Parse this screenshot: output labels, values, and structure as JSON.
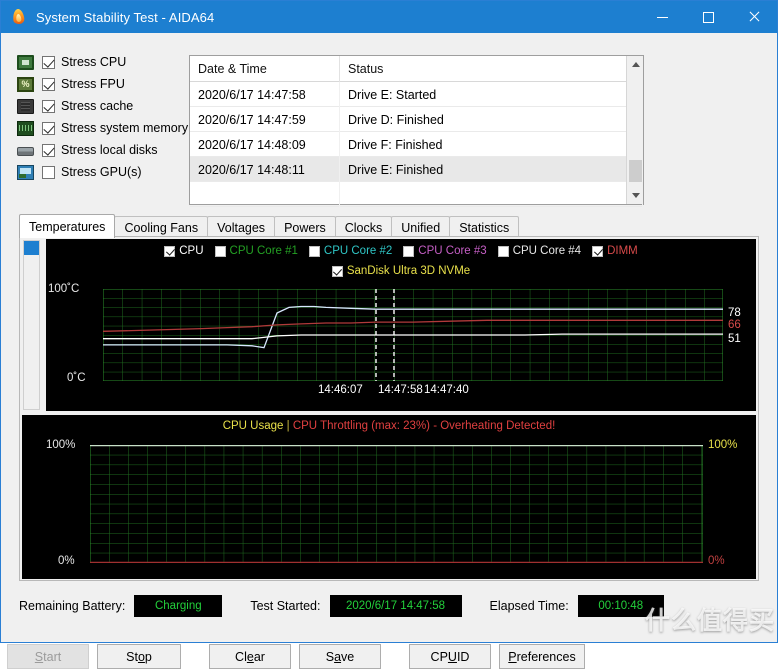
{
  "window": {
    "title": "System Stability Test - AIDA64",
    "icon": "flame-icon",
    "minimize": "—",
    "maximize": "☐",
    "close": "✕"
  },
  "stress_options": [
    {
      "label": "Stress CPU",
      "checked": true,
      "icon": "cpu-icon"
    },
    {
      "label": "Stress FPU",
      "checked": true,
      "icon": "fpu-icon"
    },
    {
      "label": "Stress cache",
      "checked": true,
      "icon": "cache-icon"
    },
    {
      "label": "Stress system memory",
      "checked": true,
      "icon": "memory-icon"
    },
    {
      "label": "Stress local disks",
      "checked": true,
      "icon": "disk-icon"
    },
    {
      "label": "Stress GPU(s)",
      "checked": false,
      "icon": "gpu-icon"
    }
  ],
  "log": {
    "columns": [
      "Date & Time",
      "Status"
    ],
    "rows": [
      {
        "datetime": "2020/6/17 14:47:58",
        "status": "Drive E: Started",
        "selected": false
      },
      {
        "datetime": "2020/6/17 14:47:59",
        "status": "Drive D: Finished",
        "selected": false
      },
      {
        "datetime": "2020/6/17 14:48:09",
        "status": "Drive F: Finished",
        "selected": false
      },
      {
        "datetime": "2020/6/17 14:48:11",
        "status": "Drive E: Finished",
        "selected": true
      }
    ]
  },
  "tabs": [
    {
      "label": "Temperatures",
      "active": true
    },
    {
      "label": "Cooling Fans",
      "active": false
    },
    {
      "label": "Voltages",
      "active": false
    },
    {
      "label": "Powers",
      "active": false
    },
    {
      "label": "Clocks",
      "active": false
    },
    {
      "label": "Unified",
      "active": false
    },
    {
      "label": "Statistics",
      "active": false
    }
  ],
  "sensor_legend": [
    {
      "label": "CPU",
      "checked": true,
      "color": "#ffffff"
    },
    {
      "label": "CPU Core #1",
      "checked": false,
      "color": "#24a024"
    },
    {
      "label": "CPU Core #2",
      "checked": false,
      "color": "#2fc6c6"
    },
    {
      "label": "CPU Core #3",
      "checked": false,
      "color": "#c65fc6"
    },
    {
      "label": "CPU Core #4",
      "checked": false,
      "color": "#e8e8e8"
    },
    {
      "label": "DIMM",
      "checked": true,
      "color": "#d64a4a"
    }
  ],
  "sensor_legend_row2": [
    {
      "label": "SanDisk Ultra 3D NVMe",
      "checked": true,
      "color": "#e8e04a"
    }
  ],
  "usage_title": {
    "main": "CPU Usage",
    "separator": "|",
    "warning": "CPU Throttling (max: 23%) - Overheating Detected!"
  },
  "status": {
    "battery_label": "Remaining Battery:",
    "battery_value": "Charging",
    "started_label": "Test Started:",
    "started_value": "2020/6/17 14:47:58",
    "elapsed_label": "Elapsed Time:",
    "elapsed_value": "00:10:48"
  },
  "buttons": [
    {
      "label": "Start",
      "accel": "S",
      "disabled": true
    },
    {
      "label": "Stop",
      "accel": "o",
      "disabled": false
    },
    {
      "label": "Clear",
      "accel": "e",
      "disabled": false
    },
    {
      "label": "Save",
      "accel": "a",
      "disabled": false
    },
    {
      "label": "CPUID",
      "accel": "U",
      "disabled": false
    },
    {
      "label": "Preferences",
      "accel": "P",
      "disabled": false
    }
  ],
  "watermark": "什么值得买",
  "chart_data": [
    {
      "type": "line",
      "id": "temperature-chart",
      "title": "",
      "ylabel": "",
      "xlabel": "",
      "y_ticks": [
        "100˚C",
        "0˚C"
      ],
      "ylim": [
        0,
        100
      ],
      "x_ticks": [
        "14:46:07",
        "14:47:58",
        "14:47:40"
      ],
      "grid": true,
      "grid_color": "#1f6b1f",
      "background": "#000000",
      "end_labels": [
        {
          "value": 78,
          "color": "#ffffff"
        },
        {
          "value": 66,
          "color": "#d64a4a"
        },
        {
          "value": 51,
          "color": "#ffffff"
        }
      ],
      "series": [
        {
          "name": "CPU",
          "color": "#d8e8ff",
          "final": 78,
          "points": [
            [
              0,
              61
            ],
            [
              6,
              61
            ],
            [
              11,
              61
            ],
            [
              16,
              61
            ],
            [
              20,
              61
            ],
            [
              24,
              60
            ],
            [
              26,
              59
            ],
            [
              28,
              74
            ],
            [
              30,
              80
            ],
            [
              32,
              81
            ],
            [
              34,
              81
            ],
            [
              36,
              80
            ],
            [
              40,
              79
            ],
            [
              44,
              78
            ],
            [
              50,
              78
            ],
            [
              56,
              78
            ],
            [
              62,
              78
            ],
            [
              68,
              78
            ],
            [
              74,
              78
            ],
            [
              80,
              78
            ],
            [
              86,
              78
            ],
            [
              92,
              78
            ],
            [
              100,
              78
            ]
          ]
        },
        {
          "name": "DIMM",
          "color": "#b03a3a",
          "final": 66,
          "points": [
            [
              0,
              54
            ],
            [
              6,
              55
            ],
            [
              11,
              56
            ],
            [
              16,
              57
            ],
            [
              20,
              58
            ],
            [
              24,
              59
            ],
            [
              28,
              61
            ],
            [
              32,
              62
            ],
            [
              36,
              63
            ],
            [
              40,
              63
            ],
            [
              44,
              64
            ],
            [
              50,
              64
            ],
            [
              56,
              65
            ],
            [
              62,
              66
            ],
            [
              68,
              66
            ],
            [
              74,
              66
            ],
            [
              80,
              66
            ],
            [
              86,
              66
            ],
            [
              92,
              66
            ],
            [
              100,
              66
            ]
          ]
        },
        {
          "name": "SanDisk Ultra 3D NVMe",
          "color": "#ffffff",
          "final": 51,
          "points": [
            [
              0,
              46
            ],
            [
              6,
              46
            ],
            [
              11,
              46
            ],
            [
              16,
              46
            ],
            [
              20,
              46
            ],
            [
              24,
              46
            ],
            [
              28,
              49
            ],
            [
              32,
              50
            ],
            [
              36,
              50
            ],
            [
              40,
              50
            ],
            [
              44,
              50
            ],
            [
              50,
              50
            ],
            [
              56,
              50
            ],
            [
              62,
              50
            ],
            [
              68,
              50
            ],
            [
              74,
              50
            ],
            [
              80,
              51
            ],
            [
              86,
              51
            ],
            [
              92,
              51
            ],
            [
              100,
              51
            ]
          ]
        }
      ],
      "markers": [
        {
          "x": 44,
          "style": "dashed",
          "color": "#ffffff"
        },
        {
          "x": 47,
          "style": "dashed",
          "color": "#ffffff"
        }
      ]
    },
    {
      "type": "line",
      "id": "cpu-usage-chart",
      "title": "CPU Usage",
      "ylabel": "",
      "xlabel": "",
      "y_ticks_left": [
        "100%",
        "0%"
      ],
      "y_ticks_right": [
        "100%",
        "0%"
      ],
      "ylim": [
        0,
        100
      ],
      "grid": true,
      "grid_color": "#1f6b1f",
      "background": "#000000",
      "top_line_color": "#c8e0c8",
      "baseline_color": "#a03030",
      "series": [
        {
          "name": "CPU Usage",
          "color": "#a03030",
          "values": [
            0,
            0,
            0,
            0,
            0,
            0,
            0,
            0,
            0,
            0,
            0,
            0
          ]
        }
      ]
    }
  ]
}
